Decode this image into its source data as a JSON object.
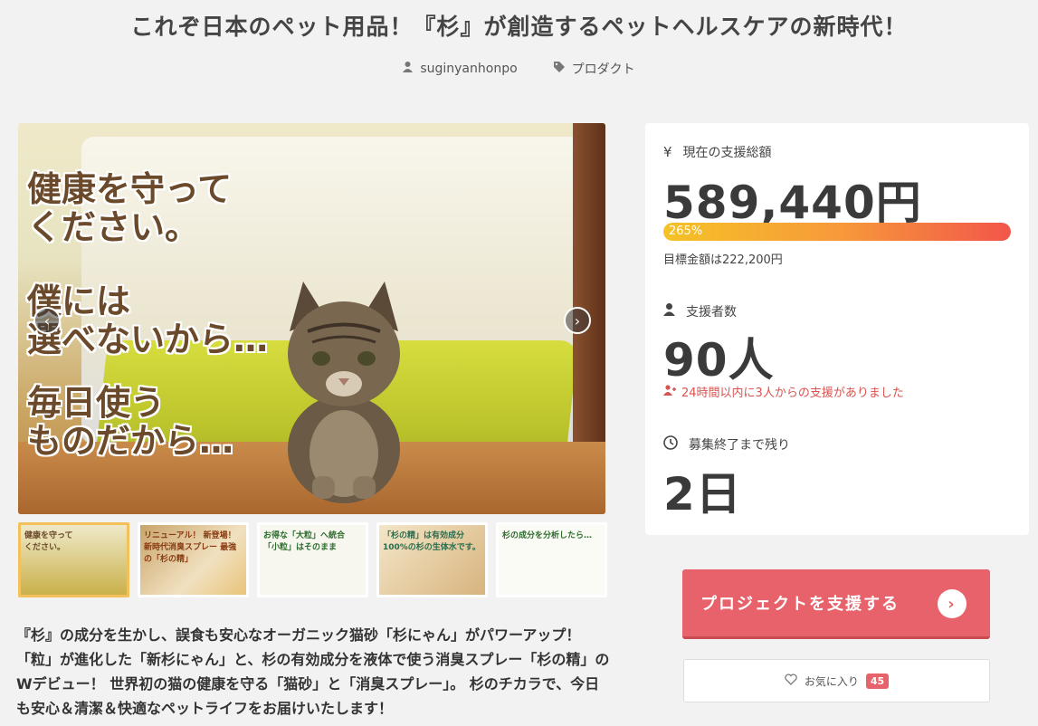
{
  "page": {
    "title": "これぞ日本のペット用品！『杉』が創造するペットヘルスケアの新時代！",
    "author": "suginyanhonpo",
    "category": "プロダクト"
  },
  "icons": {
    "author": "user-icon",
    "category": "tag-icon",
    "prev": "chevron-left-icon",
    "next": "chevron-right-icon",
    "currency": "yen-icon",
    "supporters": "user-icon",
    "recent": "users-icon",
    "time": "clock-icon",
    "favorite": "heart-icon",
    "support_go": "chevron-right-circle-icon"
  },
  "hero": {
    "lines": [
      "健康を守って\nください。",
      "僕には\n選べないから…",
      "毎日使う\nものだから…"
    ]
  },
  "thumbnails": [
    {
      "label": "健康を守って\nください。"
    },
    {
      "label": "リニューアル！ 新登場！ 新時代消臭スプレー 最強の「杉の精」"
    },
    {
      "label": "お得な「大粒」へ統合　「小粒」はそのまま"
    },
    {
      "label": "「杉の精」は有効成分100%の杉の生体水です。"
    },
    {
      "label": "杉の成分を分析したら…"
    }
  ],
  "description": "『杉』の成分を生かし、誤食も安心なオーガニック猫砂「杉にゃん」がパワーアップ！「粒」が進化した「新杉にゃん」と、杉の有効成分を液体で使う消臭スプレー「杉の精」のWデビュー！ 世界初の猫の健康を守る「猫砂」と「消臭スプレー」。 杉のチカラで、今日も安心＆清潔＆快適なペットライフをお届けいたします！",
  "stats": {
    "total_label": "現在の支援総額",
    "total_value": "589,440円",
    "progress_percent": 265,
    "progress_label": "265%",
    "goal_text": "目標金額は222,200円",
    "supporters_label": "支援者数",
    "supporters_value": "90人",
    "recent_text": "24時間以内に3人からの支援がありました",
    "remaining_label": "募集終了まで残り",
    "remaining_value": "2日"
  },
  "actions": {
    "support_label": "プロジェクトを支援する",
    "favorite_label": "お気に入り",
    "favorite_count": "45"
  },
  "colors": {
    "accent": "#e8626b",
    "progress_start": "#f5c227",
    "progress_end": "#f2564a",
    "alert": "#d9534f"
  }
}
